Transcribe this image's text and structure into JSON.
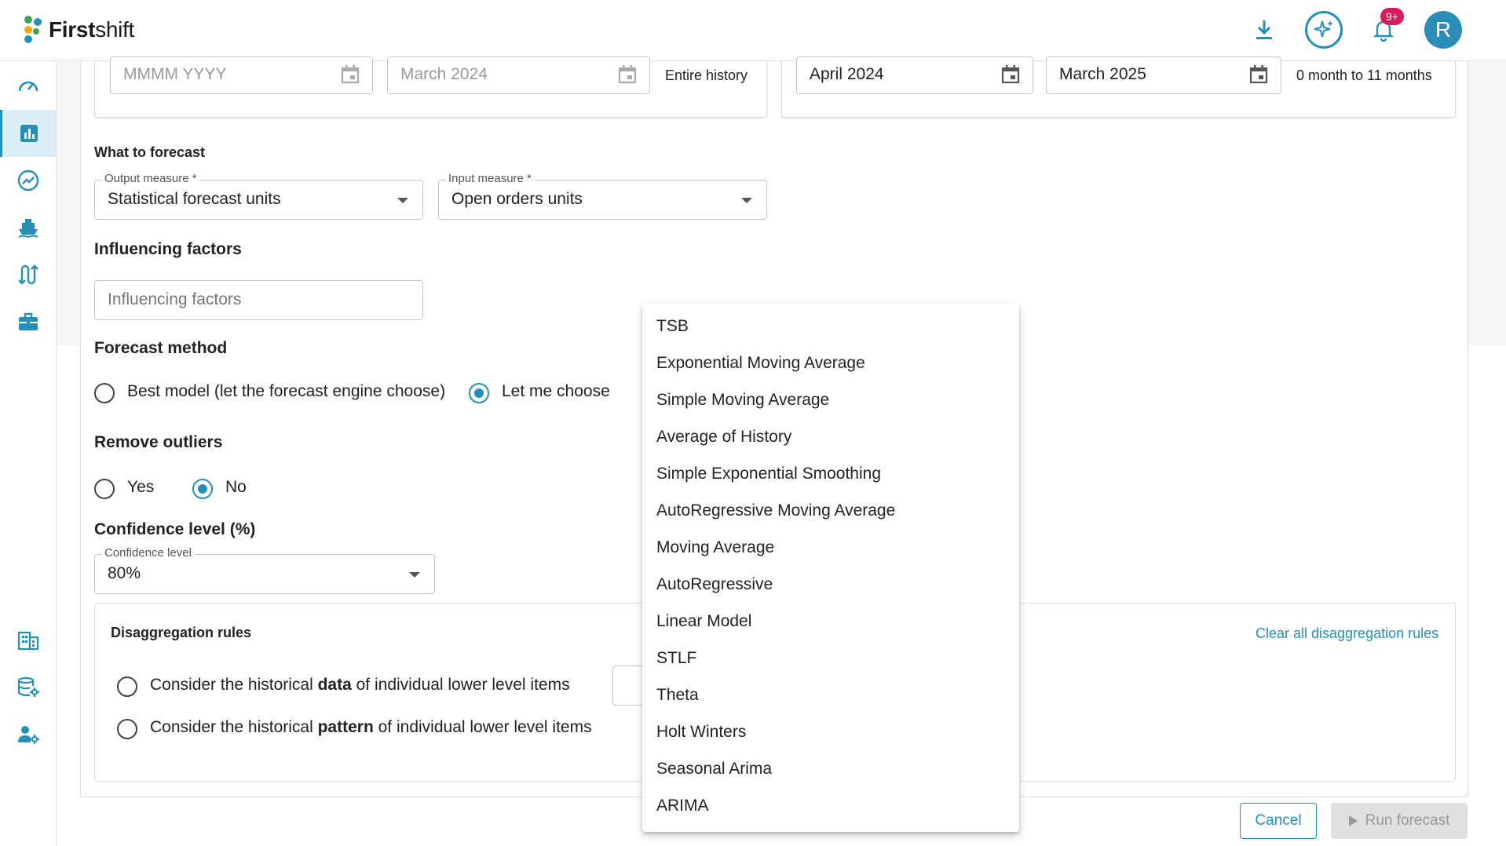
{
  "app": {
    "brand_bold": "First",
    "brand_regular": "shift"
  },
  "header": {
    "notification_count": "9+",
    "avatar_initial": "R"
  },
  "history": {
    "start_placeholder": "MMMM YYYY",
    "end_value": "March 2024",
    "summary": "Entire history"
  },
  "horizon": {
    "start_value": "April 2024",
    "end_value": "March 2025",
    "summary": "0 month to 11 months"
  },
  "what_to_forecast": {
    "heading": "What to forecast",
    "output_label": "Output measure *",
    "output_value": "Statistical forecast units",
    "input_label": "Input measure *",
    "input_value": "Open orders units"
  },
  "influencing": {
    "heading": "Influencing factors",
    "placeholder": "Influencing factors"
  },
  "forecast_method": {
    "heading": "Forecast method",
    "options": [
      "Best model (let the forecast engine choose)",
      "Let me choose"
    ],
    "selected": "Let me choose"
  },
  "outliers": {
    "heading": "Remove outliers",
    "options": [
      "Yes",
      "No"
    ],
    "selected": "No"
  },
  "confidence": {
    "heading": "Confidence level (%)",
    "label": "Confidence level",
    "value": "80%"
  },
  "disaggregation": {
    "heading": "Disaggregation rules",
    "clear_link": "Clear all disaggregation rules",
    "opt1": {
      "pre": "Consider the historical ",
      "bold": "data",
      "post": " of individual lower level items"
    },
    "opt2": {
      "pre": "Consider the historical ",
      "bold": "pattern",
      "post": " of individual lower level items"
    }
  },
  "footer": {
    "cancel_label": "Cancel",
    "run_label": "Run forecast"
  },
  "model_menu": {
    "items": [
      "TSB",
      "Exponential Moving Average",
      "Simple Moving Average",
      "Average of History",
      "Simple Exponential Smoothing",
      "AutoRegressive Moving Average",
      "Moving Average",
      "AutoRegressive",
      "Linear Model",
      "STLF",
      "Theta",
      "Holt Winters",
      "Seasonal Arima",
      "ARIMA"
    ]
  },
  "colors": {
    "accent": "#2590b6",
    "badge": "#d81b60",
    "active_nav_bg": "#dbeef5"
  }
}
